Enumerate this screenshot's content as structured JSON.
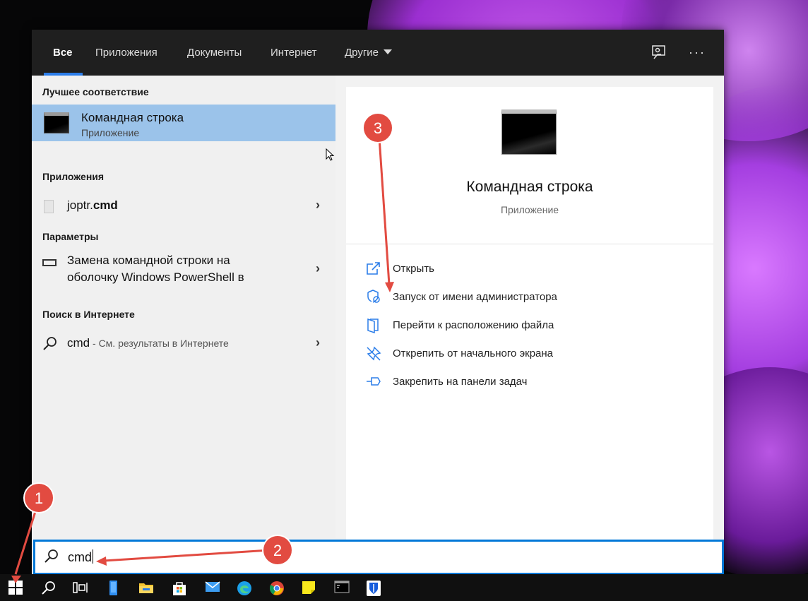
{
  "nav": {
    "tabs": [
      {
        "label": "Все"
      },
      {
        "label": "Приложения"
      },
      {
        "label": "Документы"
      },
      {
        "label": "Интернет"
      },
      {
        "label": "Другие"
      }
    ]
  },
  "sections": {
    "best_match": "Лучшее соответствие",
    "apps": "Приложения",
    "settings": "Параметры",
    "web": "Поиск в Интернете"
  },
  "best_match": {
    "title": "Командная строка",
    "subtitle": "Приложение"
  },
  "app_result": {
    "name_prefix": "joptr.",
    "name_bold": "cmd"
  },
  "setting_result": {
    "line1": "Замена командной строки на",
    "line2": "оболочку Windows PowerShell в"
  },
  "web_result": {
    "query": "cmd",
    "suffix": " - См. результаты в Интернете"
  },
  "preview": {
    "title": "Командная строка",
    "subtitle": "Приложение"
  },
  "actions": [
    {
      "label": "Открыть",
      "icon": "open-icon"
    },
    {
      "label": "Запуск от имени администратора",
      "icon": "shield-icon"
    },
    {
      "label": "Перейти к расположению файла",
      "icon": "file-location-icon"
    },
    {
      "label": "Открепить от начального экрана",
      "icon": "unpin-icon"
    },
    {
      "label": "Закрепить на панели задач",
      "icon": "pin-icon"
    }
  ],
  "search": {
    "value": "cmd"
  },
  "annotations": [
    "1",
    "2",
    "3"
  ],
  "taskbar": [
    "windows-logo-icon",
    "search-icon",
    "task-view-icon",
    "phone-icon",
    "file-explorer-icon",
    "store-icon",
    "mail-icon",
    "edge-icon",
    "chrome-icon",
    "sticky-notes-icon",
    "terminal-icon",
    "bitwarden-icon"
  ],
  "colors": {
    "accent": "#0078d7",
    "highlight": "#9bc3ea",
    "annotation": "#e24b41",
    "nav_bg": "#1f1f1f"
  }
}
